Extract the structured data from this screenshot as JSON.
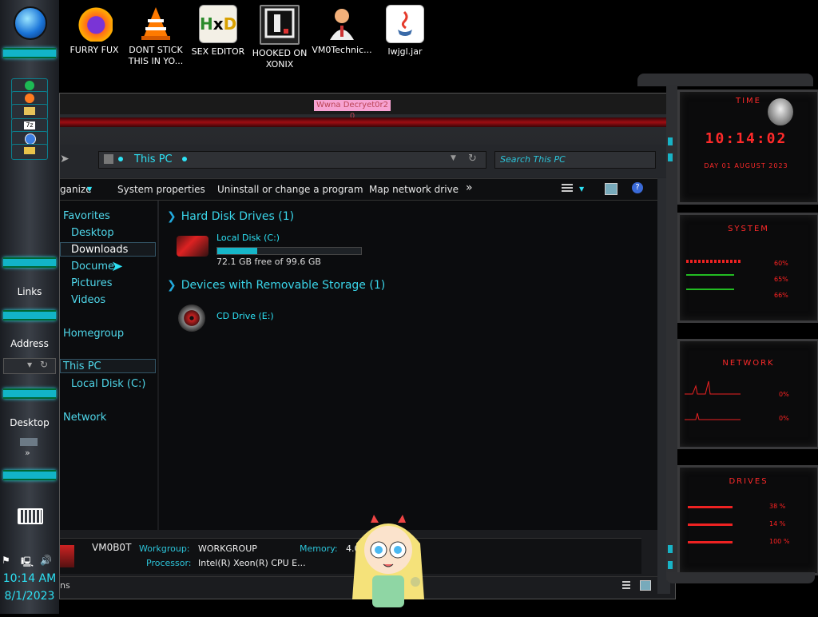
{
  "desktop_icons": [
    {
      "label": "FURRY FUX",
      "icon": "firefox-icon"
    },
    {
      "label": "DONT STICK THIS IN YO...",
      "icon": "vlc-cone-icon"
    },
    {
      "label": "SEX EDITOR",
      "icon": "hxd-editor-icon"
    },
    {
      "label": "HOOKED ON XONIX",
      "icon": "game-icon"
    },
    {
      "label": "VM0Technic...",
      "icon": "user-avatar-icon"
    },
    {
      "label": "lwjgl.jar",
      "icon": "java-icon"
    }
  ],
  "taskbar": {
    "links_label": "Links",
    "address_label": "Address",
    "desktop_label": "Desktop",
    "time": "10:14 AM",
    "date": "8/1/2023",
    "pinned": [
      "spotify-icon",
      "firefox-icon",
      "folder-icon",
      "7zip-icon",
      "chrome-icon",
      "mail-icon"
    ]
  },
  "window": {
    "title": "Wwna Decryet0r2 0",
    "address_text": "This PC",
    "search_placeholder": "Search This PC",
    "toolbar": {
      "organize": "ganize",
      "system_properties": "System properties",
      "uninstall": "Uninstall or change a program",
      "map_drive": "Map network drive",
      "more": "»"
    },
    "nav": {
      "favorites": "Favorites",
      "desktop": "Desktop",
      "downloads": "Downloads",
      "documents": "Docume",
      "pictures": "Pictures",
      "videos": "Videos",
      "homegroup": "Homegroup",
      "this_pc": "This PC",
      "local_disk": "Local Disk (C:)",
      "network": "Network"
    },
    "groups": {
      "hdd_title": "Hard Disk Drives (1)",
      "removable_title": "Devices with Removable Storage (1)"
    },
    "drive_c": {
      "name": "Local Disk (C:)",
      "free": "72.1 GB free of 99.6 GB",
      "used_fraction": 0.28
    },
    "drive_e": {
      "name": "CD Drive (E:)"
    },
    "details": {
      "computer_name": "VM0B0T",
      "workgroup_label": "Workgroup:",
      "workgroup": "WORKGROUP",
      "memory_label": "Memory:",
      "memory": "4.0",
      "processor_label": "Processor:",
      "processor": "Intel(R) Xeon(R) CPU E..."
    },
    "status_text": "ns"
  },
  "gadgets": {
    "time_title": "TIME",
    "clock": "10:14:02",
    "date_line": "DAY 01 AUGUST 2023",
    "system_title": "SYSTEM",
    "system_values": [
      "60%",
      "65%",
      "66%"
    ],
    "network_title": "NETWORK",
    "network_values": [
      "0%",
      "0%"
    ],
    "drives_title": "DRIVES",
    "drives_values": [
      "38 %",
      "14 %",
      "100 %"
    ]
  },
  "colors": {
    "accent_cyan": "#2de2f5",
    "accent_red": "#ff2222"
  }
}
